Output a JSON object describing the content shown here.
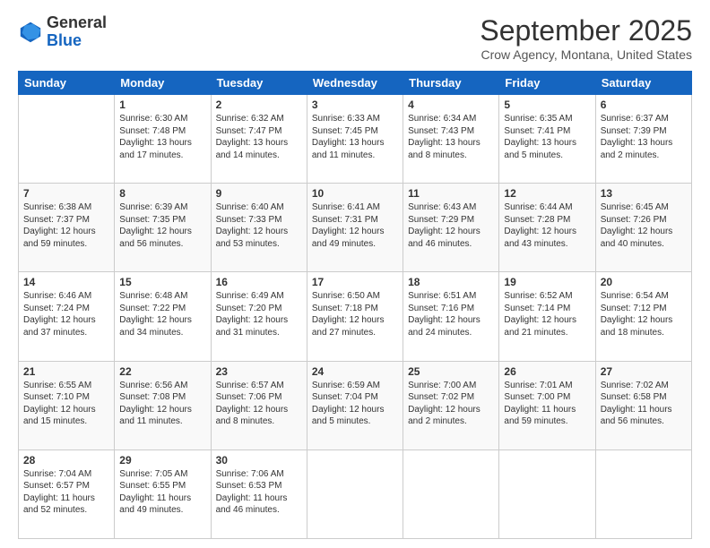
{
  "header": {
    "logo_line1": "General",
    "logo_line2": "Blue",
    "month": "September 2025",
    "location": "Crow Agency, Montana, United States"
  },
  "days_of_week": [
    "Sunday",
    "Monday",
    "Tuesday",
    "Wednesday",
    "Thursday",
    "Friday",
    "Saturday"
  ],
  "weeks": [
    [
      {
        "day": "",
        "sunrise": "",
        "sunset": "",
        "daylight": ""
      },
      {
        "day": "1",
        "sunrise": "Sunrise: 6:30 AM",
        "sunset": "Sunset: 7:48 PM",
        "daylight": "Daylight: 13 hours and 17 minutes."
      },
      {
        "day": "2",
        "sunrise": "Sunrise: 6:32 AM",
        "sunset": "Sunset: 7:47 PM",
        "daylight": "Daylight: 13 hours and 14 minutes."
      },
      {
        "day": "3",
        "sunrise": "Sunrise: 6:33 AM",
        "sunset": "Sunset: 7:45 PM",
        "daylight": "Daylight: 13 hours and 11 minutes."
      },
      {
        "day": "4",
        "sunrise": "Sunrise: 6:34 AM",
        "sunset": "Sunset: 7:43 PM",
        "daylight": "Daylight: 13 hours and 8 minutes."
      },
      {
        "day": "5",
        "sunrise": "Sunrise: 6:35 AM",
        "sunset": "Sunset: 7:41 PM",
        "daylight": "Daylight: 13 hours and 5 minutes."
      },
      {
        "day": "6",
        "sunrise": "Sunrise: 6:37 AM",
        "sunset": "Sunset: 7:39 PM",
        "daylight": "Daylight: 13 hours and 2 minutes."
      }
    ],
    [
      {
        "day": "7",
        "sunrise": "Sunrise: 6:38 AM",
        "sunset": "Sunset: 7:37 PM",
        "daylight": "Daylight: 12 hours and 59 minutes."
      },
      {
        "day": "8",
        "sunrise": "Sunrise: 6:39 AM",
        "sunset": "Sunset: 7:35 PM",
        "daylight": "Daylight: 12 hours and 56 minutes."
      },
      {
        "day": "9",
        "sunrise": "Sunrise: 6:40 AM",
        "sunset": "Sunset: 7:33 PM",
        "daylight": "Daylight: 12 hours and 53 minutes."
      },
      {
        "day": "10",
        "sunrise": "Sunrise: 6:41 AM",
        "sunset": "Sunset: 7:31 PM",
        "daylight": "Daylight: 12 hours and 49 minutes."
      },
      {
        "day": "11",
        "sunrise": "Sunrise: 6:43 AM",
        "sunset": "Sunset: 7:29 PM",
        "daylight": "Daylight: 12 hours and 46 minutes."
      },
      {
        "day": "12",
        "sunrise": "Sunrise: 6:44 AM",
        "sunset": "Sunset: 7:28 PM",
        "daylight": "Daylight: 12 hours and 43 minutes."
      },
      {
        "day": "13",
        "sunrise": "Sunrise: 6:45 AM",
        "sunset": "Sunset: 7:26 PM",
        "daylight": "Daylight: 12 hours and 40 minutes."
      }
    ],
    [
      {
        "day": "14",
        "sunrise": "Sunrise: 6:46 AM",
        "sunset": "Sunset: 7:24 PM",
        "daylight": "Daylight: 12 hours and 37 minutes."
      },
      {
        "day": "15",
        "sunrise": "Sunrise: 6:48 AM",
        "sunset": "Sunset: 7:22 PM",
        "daylight": "Daylight: 12 hours and 34 minutes."
      },
      {
        "day": "16",
        "sunrise": "Sunrise: 6:49 AM",
        "sunset": "Sunset: 7:20 PM",
        "daylight": "Daylight: 12 hours and 31 minutes."
      },
      {
        "day": "17",
        "sunrise": "Sunrise: 6:50 AM",
        "sunset": "Sunset: 7:18 PM",
        "daylight": "Daylight: 12 hours and 27 minutes."
      },
      {
        "day": "18",
        "sunrise": "Sunrise: 6:51 AM",
        "sunset": "Sunset: 7:16 PM",
        "daylight": "Daylight: 12 hours and 24 minutes."
      },
      {
        "day": "19",
        "sunrise": "Sunrise: 6:52 AM",
        "sunset": "Sunset: 7:14 PM",
        "daylight": "Daylight: 12 hours and 21 minutes."
      },
      {
        "day": "20",
        "sunrise": "Sunrise: 6:54 AM",
        "sunset": "Sunset: 7:12 PM",
        "daylight": "Daylight: 12 hours and 18 minutes."
      }
    ],
    [
      {
        "day": "21",
        "sunrise": "Sunrise: 6:55 AM",
        "sunset": "Sunset: 7:10 PM",
        "daylight": "Daylight: 12 hours and 15 minutes."
      },
      {
        "day": "22",
        "sunrise": "Sunrise: 6:56 AM",
        "sunset": "Sunset: 7:08 PM",
        "daylight": "Daylight: 12 hours and 11 minutes."
      },
      {
        "day": "23",
        "sunrise": "Sunrise: 6:57 AM",
        "sunset": "Sunset: 7:06 PM",
        "daylight": "Daylight: 12 hours and 8 minutes."
      },
      {
        "day": "24",
        "sunrise": "Sunrise: 6:59 AM",
        "sunset": "Sunset: 7:04 PM",
        "daylight": "Daylight: 12 hours and 5 minutes."
      },
      {
        "day": "25",
        "sunrise": "Sunrise: 7:00 AM",
        "sunset": "Sunset: 7:02 PM",
        "daylight": "Daylight: 12 hours and 2 minutes."
      },
      {
        "day": "26",
        "sunrise": "Sunrise: 7:01 AM",
        "sunset": "Sunset: 7:00 PM",
        "daylight": "Daylight: 11 hours and 59 minutes."
      },
      {
        "day": "27",
        "sunrise": "Sunrise: 7:02 AM",
        "sunset": "Sunset: 6:58 PM",
        "daylight": "Daylight: 11 hours and 56 minutes."
      }
    ],
    [
      {
        "day": "28",
        "sunrise": "Sunrise: 7:04 AM",
        "sunset": "Sunset: 6:57 PM",
        "daylight": "Daylight: 11 hours and 52 minutes."
      },
      {
        "day": "29",
        "sunrise": "Sunrise: 7:05 AM",
        "sunset": "Sunset: 6:55 PM",
        "daylight": "Daylight: 11 hours and 49 minutes."
      },
      {
        "day": "30",
        "sunrise": "Sunrise: 7:06 AM",
        "sunset": "Sunset: 6:53 PM",
        "daylight": "Daylight: 11 hours and 46 minutes."
      },
      {
        "day": "",
        "sunrise": "",
        "sunset": "",
        "daylight": ""
      },
      {
        "day": "",
        "sunrise": "",
        "sunset": "",
        "daylight": ""
      },
      {
        "day": "",
        "sunrise": "",
        "sunset": "",
        "daylight": ""
      },
      {
        "day": "",
        "sunrise": "",
        "sunset": "",
        "daylight": ""
      }
    ]
  ]
}
